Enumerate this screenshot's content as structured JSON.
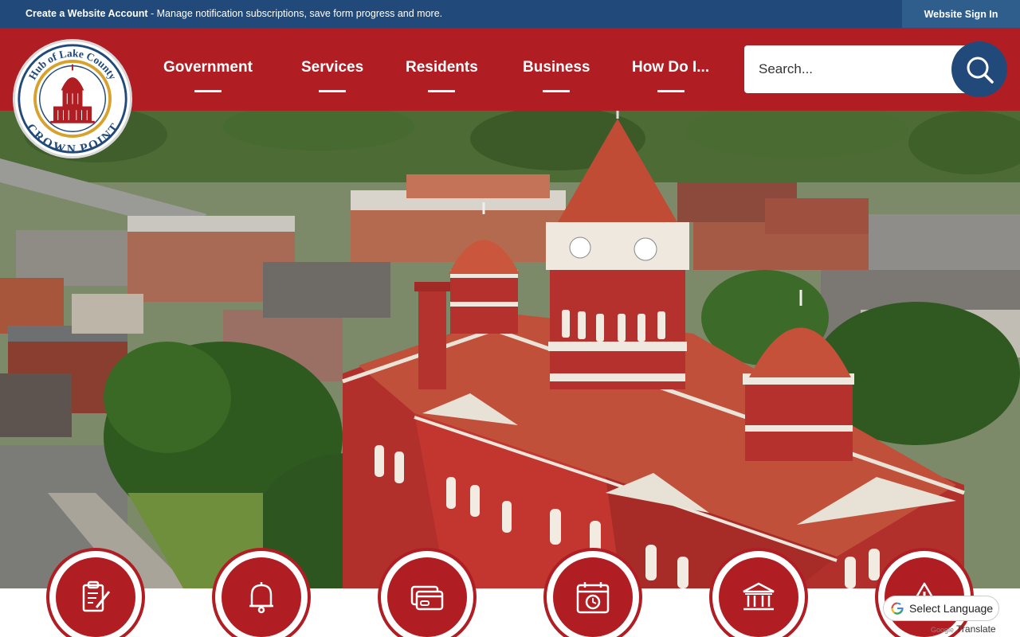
{
  "topbar": {
    "account_link": "Create a Website Account",
    "account_desc": " - Manage notification subscriptions, save form progress and more.",
    "signin": "Website Sign In",
    "bg_color": "#214a7a"
  },
  "logo": {
    "text_top": "Hub of Lake County",
    "text_bottom": "CROWN POINT",
    "icon": "courthouse-seal"
  },
  "nav": {
    "items": [
      {
        "label": "Government"
      },
      {
        "label": "Services"
      },
      {
        "label": "Residents"
      },
      {
        "label": "Business"
      },
      {
        "label": "How Do I..."
      }
    ]
  },
  "search": {
    "placeholder": "Search...",
    "icon": "search-icon"
  },
  "hero": {
    "description_icon": "aerial-courthouse-photo"
  },
  "quick_links": [
    {
      "icon": "clipboard-pen-icon"
    },
    {
      "icon": "bell-icon"
    },
    {
      "icon": "credit-card-icon"
    },
    {
      "icon": "calendar-clock-icon"
    },
    {
      "icon": "government-building-icon"
    },
    {
      "icon": "warning-icon"
    }
  ],
  "translate": {
    "select_label": "Select Language",
    "powered_by": "Translate",
    "google": "Google"
  },
  "colors": {
    "brand_red": "#b01e23",
    "brand_blue": "#214a7a"
  }
}
